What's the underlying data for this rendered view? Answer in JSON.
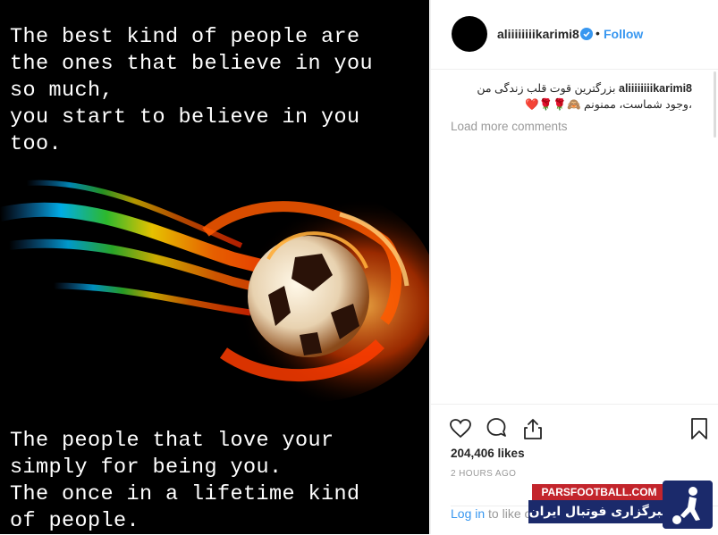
{
  "post": {
    "quote_top": "The best kind of people are\nthe ones that believe in you\nso much,\nyou start to believe in you\ntoo.",
    "quote_bottom": "The people that love your\nsimply for being you.\nThe once in a lifetime kind\nof people."
  },
  "header": {
    "username": "aliiiiiiiikarimi8",
    "dot": "•",
    "follow_label": "Follow"
  },
  "comments": {
    "caption_user": "aliiiiiiiikarimi8",
    "caption_text": "بزرگترین قوت قلب زندگی من ،وجود شماست، ممنونم 🙈🌹🌹❤️",
    "load_more": "Load more comments"
  },
  "actions": {
    "likes": "204,406 likes",
    "time": "2 HOURS AGO",
    "login_link": "Log in",
    "login_rest": " to like or comment."
  },
  "watermark": {
    "site": "PARSFOOTBALL.COM",
    "persian": "خبرگزاری فوتبال ایران"
  },
  "colors": {
    "accent": "#3897f0",
    "muted": "#999999",
    "text": "#262626"
  },
  "icons": [
    "verified-badge-icon",
    "heart-icon",
    "comment-icon",
    "share-icon",
    "bookmark-icon"
  ]
}
